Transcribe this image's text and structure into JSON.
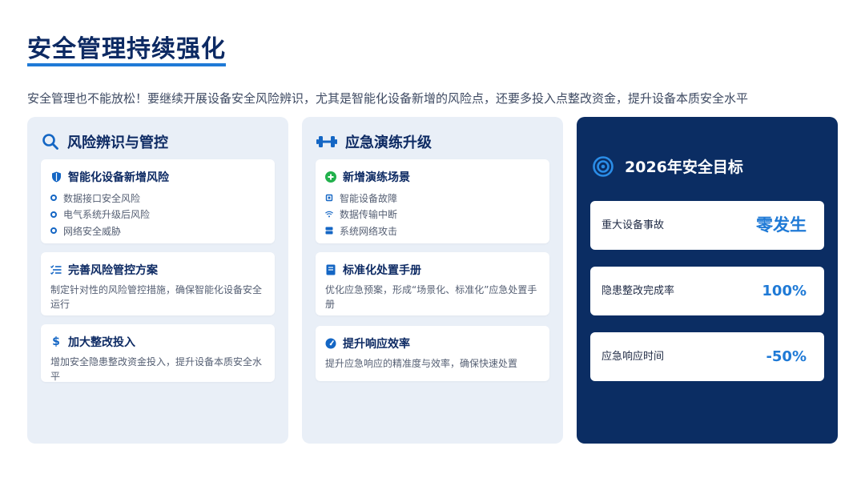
{
  "page": {
    "title": "安全管理持续强化",
    "subtitle": "安全管理也不能放松！要继续开展设备安全风险辨识，尤其是智能化设备新增的风险点，还要多投入点整改资金，提升设备本质安全水平"
  },
  "left": {
    "title": "风险辨识与管控",
    "icon": "search-icon",
    "cards": [
      {
        "title": "智能化设备新增风险",
        "icon": "shield-icon",
        "items": [
          "数据接口安全风险",
          "电气系统升级后风险",
          "网络安全威胁"
        ]
      },
      {
        "title": "完善风险管控方案",
        "icon": "checklist-icon",
        "desc": "制定针对性的风险管控措施，确保智能化设备安全运行"
      },
      {
        "title": "加大整改投入",
        "icon": "dollar-icon",
        "desc": "增加安全隐患整改资金投入，提升设备本质安全水平"
      }
    ]
  },
  "middle": {
    "title": "应急演练升级",
    "icon": "dumbbell-icon",
    "cards": [
      {
        "title": "新增演练场景",
        "icon": "plus-circle-icon",
        "items": [
          {
            "label": "智能设备故障",
            "icon": "chip-icon"
          },
          {
            "label": "数据传输中断",
            "icon": "wifi-icon"
          },
          {
            "label": "系统网络攻击",
            "icon": "server-icon"
          }
        ]
      },
      {
        "title": "标准化处置手册",
        "icon": "book-icon",
        "desc": "优化应急预案，形成“场景化、标准化”应急处置手册"
      },
      {
        "title": "提升响应效率",
        "icon": "gauge-icon",
        "desc": "提升应急响应的精准度与效率，确保快速处置"
      }
    ]
  },
  "right": {
    "title": "2026年安全目标",
    "icon": "target-icon",
    "goals": [
      {
        "label": "重大设备事故",
        "value": "零发生"
      },
      {
        "label": "隐患整改完成率",
        "value": "100%"
      },
      {
        "label": "应急响应时间",
        "value": "-50%"
      }
    ]
  },
  "colors": {
    "navy": "#0b2d63",
    "accent": "#1f7ad6",
    "panel": "#e9eff7",
    "green": "#22b14c"
  }
}
